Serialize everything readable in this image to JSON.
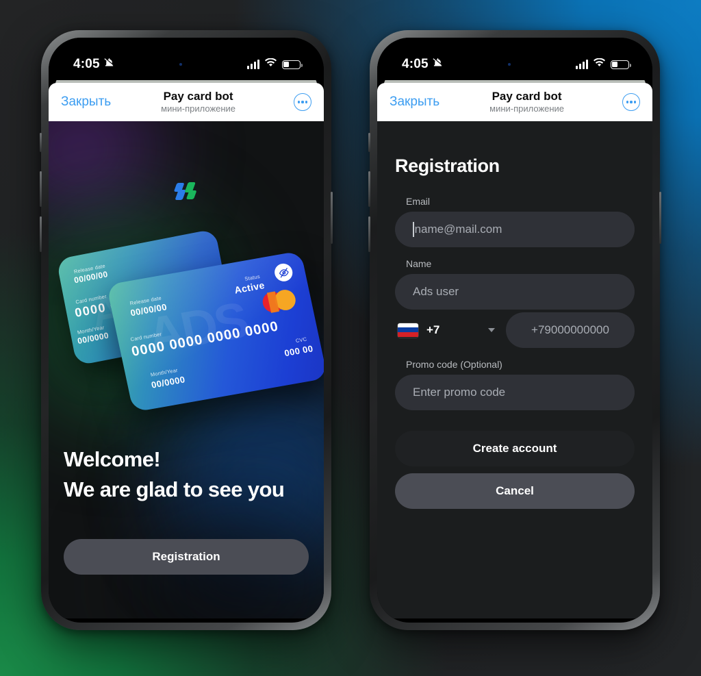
{
  "background": {
    "accent_green": "#12713c",
    "accent_blue": "#0b72b5",
    "base_dark": "#232425"
  },
  "status_bar": {
    "time": "4:05",
    "silent_icon": "bell-off-icon",
    "signal_icon": "cellular-bars-icon",
    "wifi_icon": "wifi-icon",
    "battery_icon": "battery-icon",
    "battery_level": "32%"
  },
  "mini_app_header": {
    "close_label": "Закрыть",
    "title": "Pay card bot",
    "subtitle": "мини-приложение",
    "menu_icon": "more-options-icon",
    "accent_color": "#3c9df1"
  },
  "welcome_screen": {
    "logo_icon": "app-logo-icon",
    "logo_colors": {
      "blue": "#2b7de9",
      "green": "#1ab65c"
    },
    "heading_line1": "Welcome!",
    "heading_line2": "We are glad to see you",
    "cta_label": "Registration",
    "cards": {
      "back_card": {
        "watermark": "ADS",
        "release_date_label": "Release date",
        "release_date_value": "00/00/00",
        "card_number_label": "Card number",
        "card_number_value": "0000 0000 0000 0000",
        "month_year_label": "Month/Year",
        "month_year_value": "00/0000"
      },
      "front_card": {
        "watermark": "ADS",
        "release_date_label": "Release date",
        "release_date_value": "00/00/00",
        "card_number_label": "Card number",
        "card_number_value": "0000 0000 0000 0000",
        "month_year_label": "Month/Year",
        "month_year_value": "00/0000",
        "status_label": "Status",
        "status_value": "Active",
        "cvc_label": "CVC",
        "cvc_value": "000 00",
        "hide_icon": "eye-off-icon",
        "network_icon": "mastercard-icon"
      }
    }
  },
  "registration_screen": {
    "title": "Registration",
    "email": {
      "label": "Email",
      "placeholder": "name@mail.com",
      "value": ""
    },
    "name": {
      "label": "Name",
      "placeholder": "Ads user",
      "value": ""
    },
    "phone": {
      "country_flag": "russia-flag-icon",
      "country_code": "+7",
      "dropdown_icon": "chevron-down-icon",
      "placeholder": "+79000000000",
      "value": ""
    },
    "promo": {
      "label": "Promo code (Optional)",
      "placeholder": "Enter promo code",
      "value": ""
    },
    "submit_label": "Create account",
    "cancel_label": "Cancel"
  }
}
